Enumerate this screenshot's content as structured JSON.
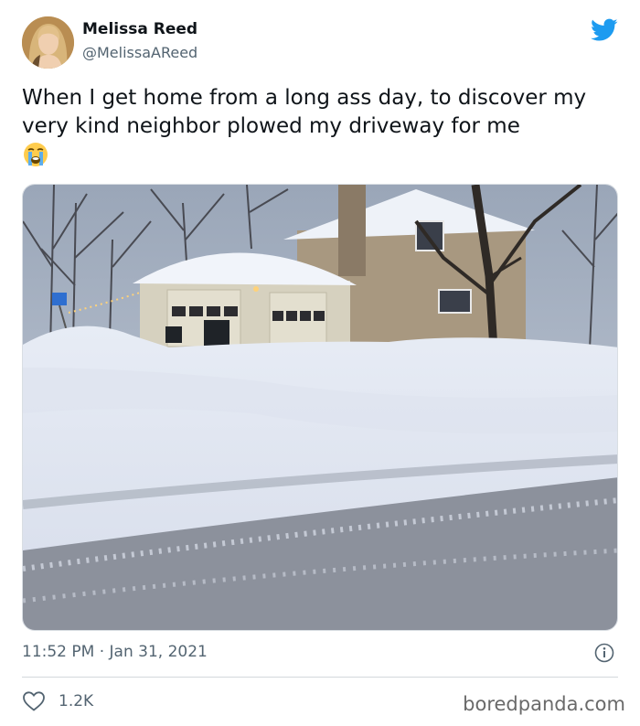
{
  "author": {
    "name": "Melissa Reed",
    "handle": "@MelissaAReed"
  },
  "tweet": {
    "text": "When I get home from a long ass day, to discover my very kind neighbor plowed my driveway for me",
    "emoji": "loudly-crying-face"
  },
  "meta": {
    "time": "11:52 PM",
    "separator": "·",
    "date": "Jan 31, 2021"
  },
  "engagement": {
    "likes": "1.2K"
  },
  "watermark": "boredpanda.com",
  "icons": {
    "brand": "twitter-bird-icon",
    "like": "heart-icon",
    "info": "info-icon"
  },
  "colors": {
    "twitter_blue": "#1d9bf0",
    "secondary_text": "#536471",
    "primary_text": "#0f1419"
  }
}
